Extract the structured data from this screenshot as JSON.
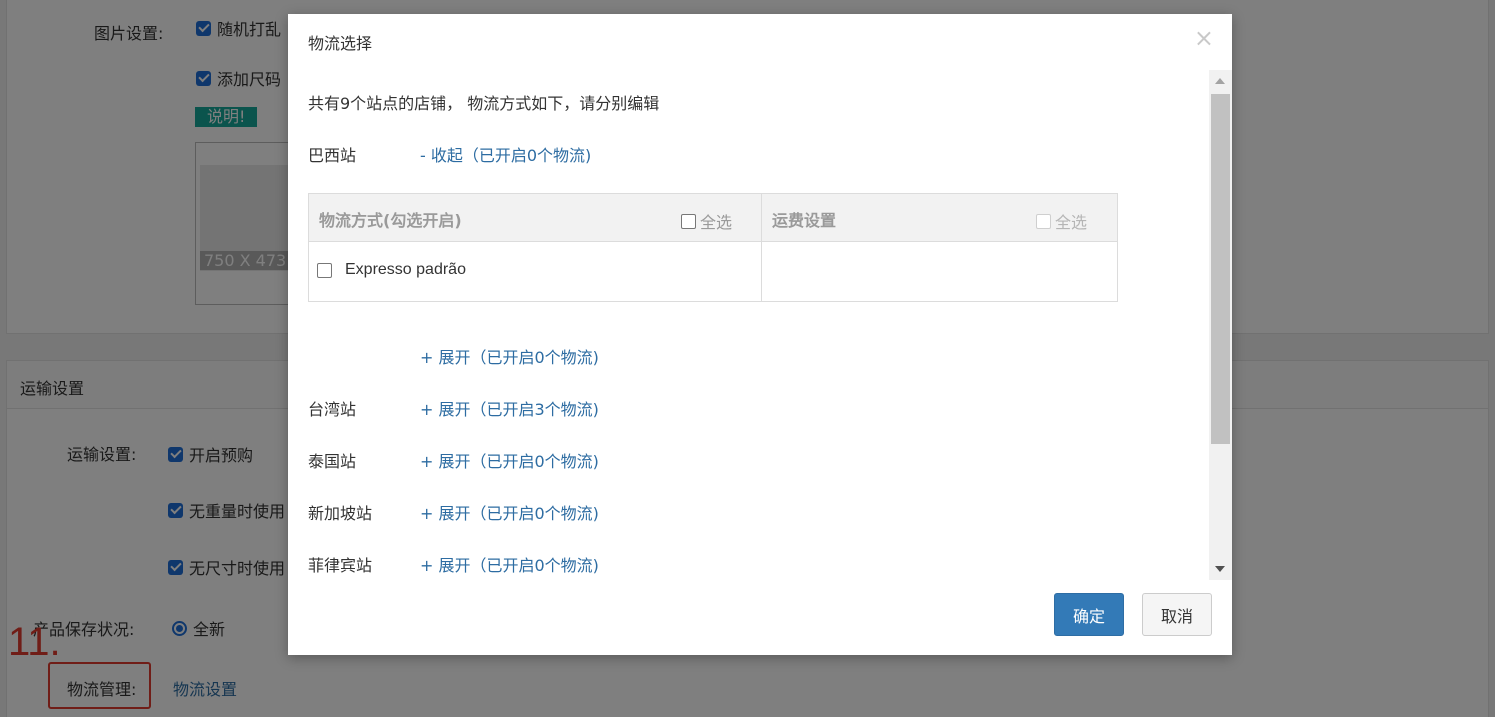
{
  "background": {
    "image_settings": {
      "label": "图片设置:",
      "option_1": "随机打乱",
      "option_2": "添加尺码",
      "explain_btn": "说明!",
      "thumb_size": "750 X 473"
    },
    "shipping_section": {
      "title": "运输设置",
      "label": "运输设置:",
      "option_1": "开启预购",
      "option_2": "无重量时使用",
      "option_3": "无尺寸时使用"
    },
    "condition": {
      "label": "产品保存状况:",
      "value": "全新"
    },
    "logistics": {
      "label": "物流管理:",
      "link": "物流设置"
    },
    "annotation": {
      "number": "11."
    }
  },
  "modal": {
    "title": "物流选择",
    "close": "×",
    "intro": "共有9个站点的店铺， 物流方式如下，请分别编辑",
    "sites": [
      {
        "name": "巴西站",
        "toggle": "- 收起（已开启0个物流)"
      },
      {
        "name": "",
        "toggle": "+ 展开（已开启0个物流)"
      },
      {
        "name": "台湾站",
        "toggle": "+ 展开（已开启3个物流)"
      },
      {
        "name": "泰国站",
        "toggle": "+ 展开（已开启0个物流)"
      },
      {
        "name": "新加坡站",
        "toggle": "+ 展开（已开启0个物流)"
      },
      {
        "name": "菲律宾站",
        "toggle": "+ 展开（已开启0个物流)"
      }
    ],
    "table": {
      "col_method": "物流方式(勾选开启)",
      "col_method_selectall": "全选",
      "col_fee": "运费设置",
      "col_fee_selectall": "全选",
      "rows": [
        {
          "method": "Expresso padrão",
          "fee": ""
        }
      ]
    },
    "ok_button": "确定",
    "cancel_button": "取消"
  },
  "colors": {
    "primary": "#337ab7",
    "link": "#2d6ca2",
    "annotation": "#e13b2e",
    "checkbox": "#1e6fd9"
  }
}
